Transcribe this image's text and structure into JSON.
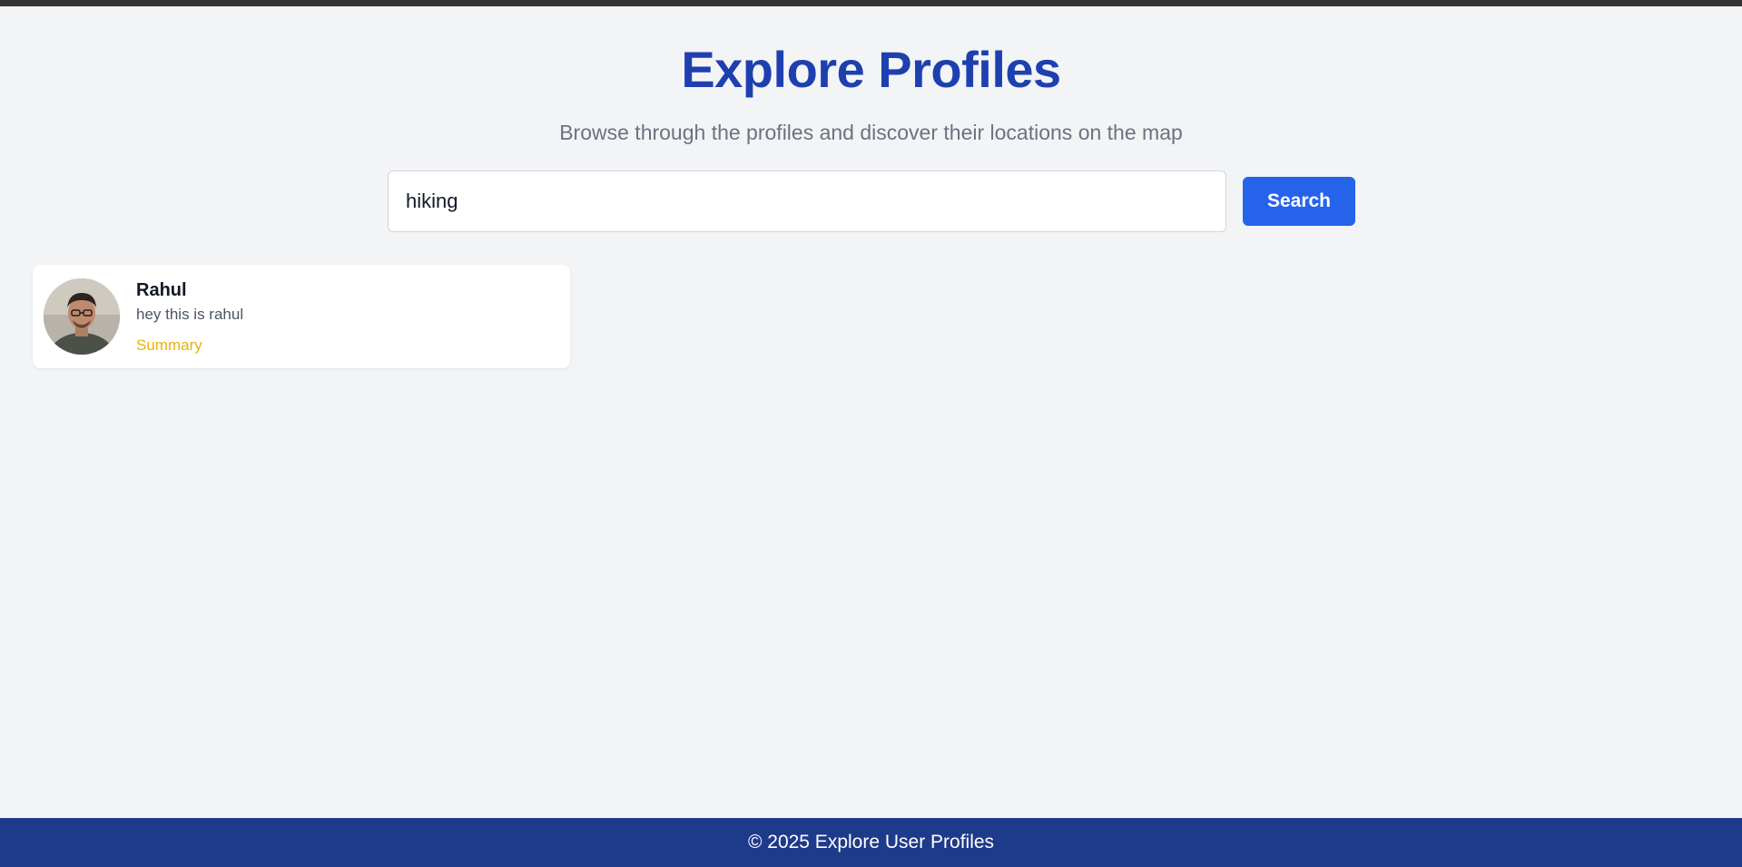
{
  "header": {
    "title": "Explore Profiles",
    "subtitle": "Browse through the profiles and discover their locations on the map"
  },
  "search": {
    "value": "hiking",
    "button_label": "Search"
  },
  "profiles": [
    {
      "name": "Rahul",
      "bio": "hey this is rahul",
      "summary_label": "Summary",
      "avatar_icon": "avatar-photo"
    }
  ],
  "footer": {
    "text": "© 2025 Explore User Profiles"
  },
  "colors": {
    "title": "#1e40af",
    "accent_button": "#2563eb",
    "summary_link": "#eab308",
    "footer_bg": "#1e3a8a",
    "page_bg": "#f3f4f6"
  }
}
